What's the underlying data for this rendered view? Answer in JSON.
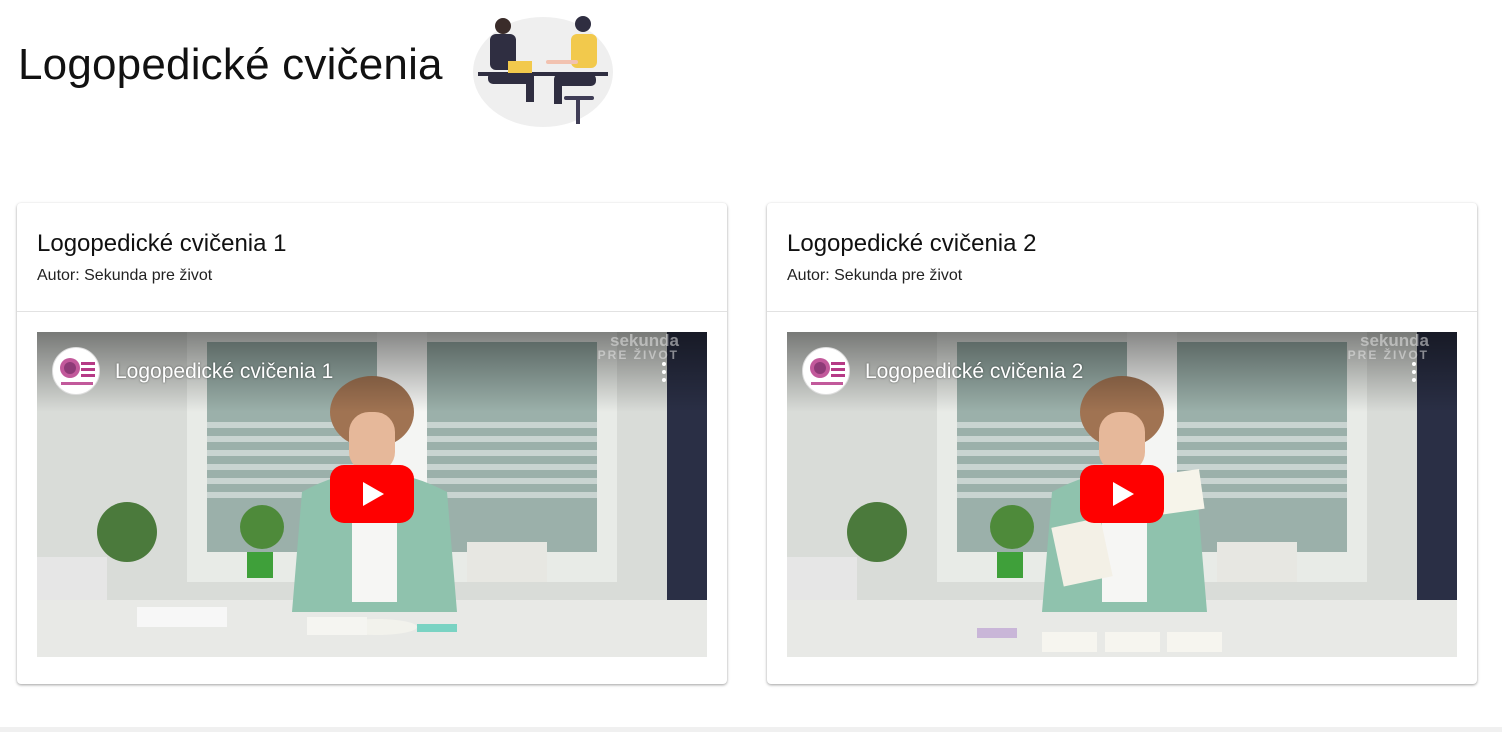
{
  "page": {
    "title": "Logopedické cvičenia"
  },
  "cards": [
    {
      "title": "Logopedické cvičenia 1",
      "author": "Autor: Sekunda pre život",
      "video": {
        "title": "Logopedické cvičenia 1",
        "watermark_line1": "sekunda",
        "watermark_line2": "PRE ŽIVOT"
      }
    },
    {
      "title": "Logopedické cvičenia 2",
      "author": "Autor: Sekunda pre život",
      "video": {
        "title": "Logopedické cvičenia 2",
        "watermark_line1": "sekunda",
        "watermark_line2": "PRE ŽIVOT"
      }
    }
  ],
  "icons": {
    "play": "play-icon",
    "menu": "more-vert-icon",
    "channel": "channel-avatar"
  },
  "colors": {
    "youtube_red": "#ff0000",
    "illustration_yellow": "#f2c94c",
    "illustration_dark": "#2f2e41"
  }
}
